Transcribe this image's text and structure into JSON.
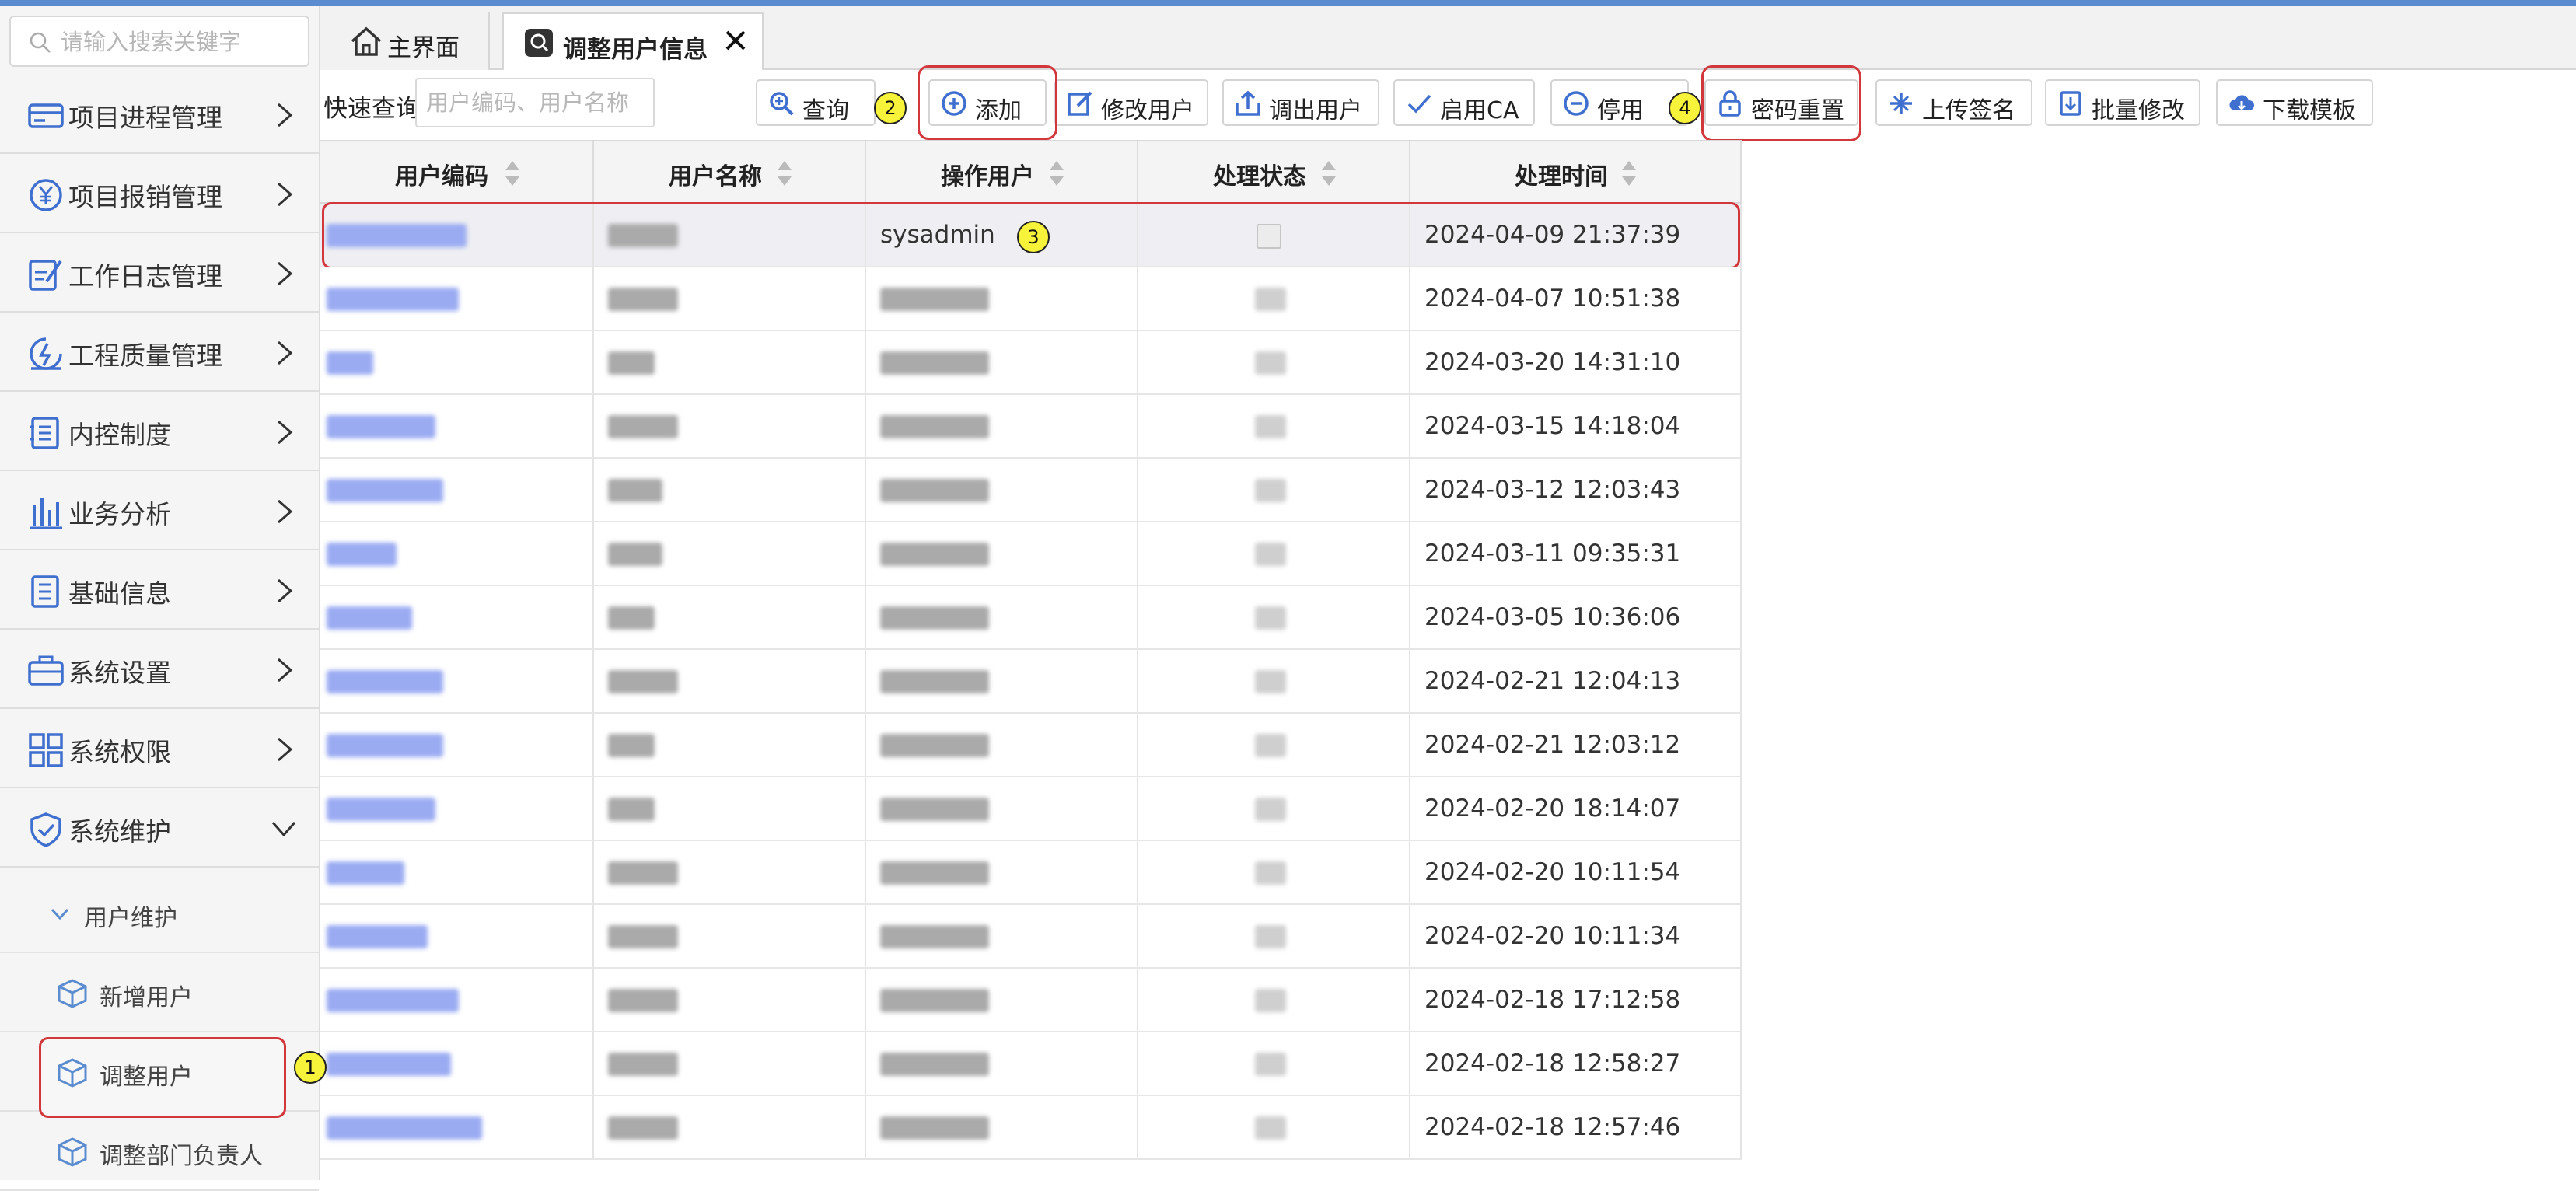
{
  "colors": {
    "accent": "#5b8ccf",
    "icon_blue": "#3f6fcf",
    "highlight_red": "#d2373c",
    "badge_yellow": "#f7f23a"
  },
  "sidebar": {
    "search_placeholder": "请输入搜索关键字",
    "menu": [
      {
        "label": "项目进程管理",
        "icon": "card-icon"
      },
      {
        "label": "项目报销管理",
        "icon": "yen-icon"
      },
      {
        "label": "工作日志管理",
        "icon": "edit-doc-icon"
      },
      {
        "label": "工程质量管理",
        "icon": "gauge-icon"
      },
      {
        "label": "内控制度",
        "icon": "checklist-icon"
      },
      {
        "label": "业务分析",
        "icon": "bar-chart-icon"
      },
      {
        "label": "基础信息",
        "icon": "list-icon"
      },
      {
        "label": "系统设置",
        "icon": "briefcase-icon"
      },
      {
        "label": "系统权限",
        "icon": "grid-icon"
      },
      {
        "label": "系统维护",
        "icon": "shield-icon",
        "expanded": true
      }
    ],
    "submenu_header": "用户维护",
    "submenu_items": [
      {
        "label": "新增用户",
        "icon": "cube-icon"
      },
      {
        "label": "调整用户",
        "icon": "cube-icon",
        "active": true
      },
      {
        "label": "调整部门负责人",
        "icon": "cube-icon"
      }
    ]
  },
  "tabs": [
    {
      "label": "主界面",
      "icon": "home-icon"
    },
    {
      "label": "调整用户信息",
      "icon": "search-doc-icon",
      "active": true,
      "closable": true
    }
  ],
  "toolbar": {
    "quick_search_label": "快速查询",
    "quick_search_placeholder": "用户编码、用户名称",
    "buttons": [
      {
        "label": "查询",
        "icon": "zoom-icon"
      },
      {
        "label": "添加",
        "icon": "plus-circle-icon"
      },
      {
        "label": "修改用户",
        "icon": "edit-icon"
      },
      {
        "label": "调出用户",
        "icon": "export-icon"
      },
      {
        "label": "启用CA",
        "icon": "check-icon"
      },
      {
        "label": "停用",
        "icon": "minus-circle-icon"
      },
      {
        "label": "密码重置",
        "icon": "lock-icon"
      },
      {
        "label": "上传签名",
        "icon": "sparkle-icon"
      },
      {
        "label": "批量修改",
        "icon": "download-doc-icon"
      },
      {
        "label": "下载模板",
        "icon": "cloud-download-icon"
      }
    ]
  },
  "annotations": [
    "1",
    "2",
    "3",
    "4"
  ],
  "table": {
    "columns": [
      "用户编码",
      "用户名称",
      "操作用户",
      "处理状态",
      "处理时间"
    ],
    "rows": [
      {
        "operator": "sysadmin",
        "time": "2024-04-09 21:37:39"
      },
      {
        "operator": "",
        "time": "2024-04-07 10:51:38"
      },
      {
        "operator": "",
        "time": "2024-03-20 14:31:10"
      },
      {
        "operator": "",
        "time": "2024-03-15 14:18:04"
      },
      {
        "operator": "",
        "time": "2024-03-12 12:03:43"
      },
      {
        "operator": "",
        "time": "2024-03-11 09:35:31"
      },
      {
        "operator": "",
        "time": "2024-03-05 10:36:06"
      },
      {
        "operator": "",
        "time": "2024-02-21 12:04:13"
      },
      {
        "operator": "",
        "time": "2024-02-21 12:03:12"
      },
      {
        "operator": "",
        "time": "2024-02-20 18:14:07"
      },
      {
        "operator": "",
        "time": "2024-02-20 10:11:54"
      },
      {
        "operator": "",
        "time": "2024-02-20 10:11:34"
      },
      {
        "operator": "",
        "time": "2024-02-18 17:12:58"
      },
      {
        "operator": "",
        "time": "2024-02-18 12:58:27"
      },
      {
        "operator": "",
        "time": "2024-02-18 12:57:46"
      }
    ]
  }
}
